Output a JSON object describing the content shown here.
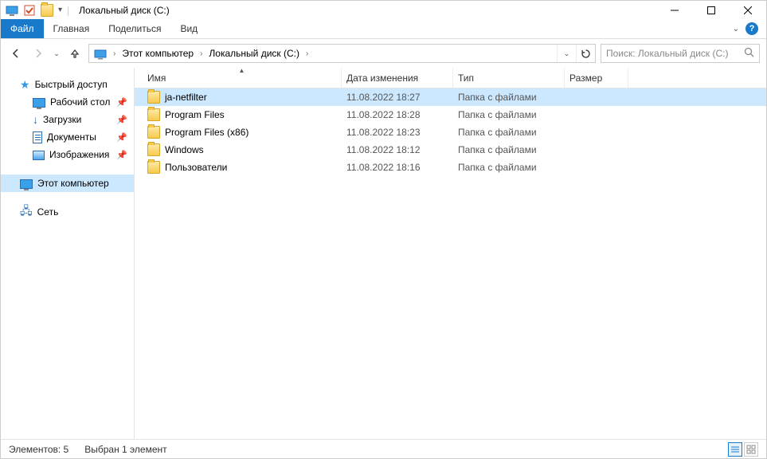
{
  "title": "Локальный диск (C:)",
  "menu": {
    "file": "Файл",
    "home": "Главная",
    "share": "Поделиться",
    "view": "Вид"
  },
  "breadcrumbs": [
    {
      "label": "Этот компьютер"
    },
    {
      "label": "Локальный диск (C:)"
    }
  ],
  "search": {
    "placeholder": "Поиск: Локальный диск (C:)"
  },
  "navpane": {
    "quick_access": "Быстрый доступ",
    "desktop": "Рабочий стол",
    "downloads": "Загрузки",
    "documents": "Документы",
    "pictures": "Изображения",
    "this_pc": "Этот компьютер",
    "network": "Сеть"
  },
  "columns": {
    "name": "Имя",
    "modified": "Дата изменения",
    "type": "Тип",
    "size": "Размер"
  },
  "rows": [
    {
      "name": "ja-netfilter",
      "modified": "11.08.2022 18:27",
      "type": "Папка с файлами",
      "selected": true
    },
    {
      "name": "Program Files",
      "modified": "11.08.2022 18:28",
      "type": "Папка с файлами",
      "selected": false
    },
    {
      "name": "Program Files (x86)",
      "modified": "11.08.2022 18:23",
      "type": "Папка с файлами",
      "selected": false
    },
    {
      "name": "Windows",
      "modified": "11.08.2022 18:12",
      "type": "Папка с файлами",
      "selected": false
    },
    {
      "name": "Пользователи",
      "modified": "11.08.2022 18:16",
      "type": "Папка с файлами",
      "selected": false
    }
  ],
  "status": {
    "count": "Элементов: 5",
    "selection": "Выбран 1 элемент"
  }
}
